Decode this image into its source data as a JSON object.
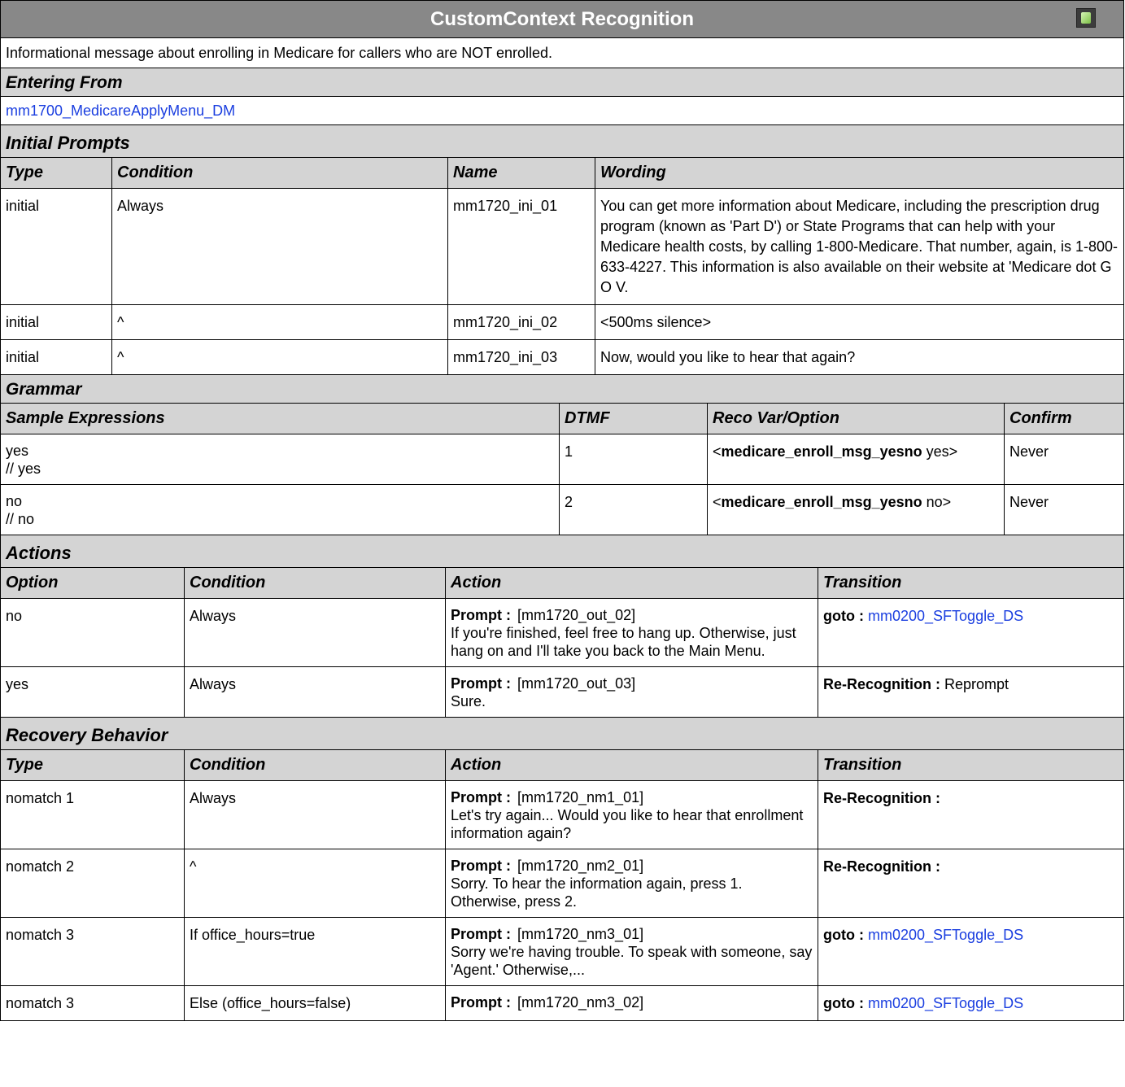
{
  "title": "CustomContext Recognition",
  "description": "Informational message about enrolling in Medicare for callers who are NOT enrolled.",
  "entering_from": {
    "label": "Entering From",
    "link": "mm1700_MedicareApplyMenu_DM"
  },
  "initial_prompts": {
    "label": "Initial Prompts",
    "columns": [
      "Type",
      "Condition",
      "Name",
      "Wording"
    ],
    "rows": [
      {
        "type": "initial",
        "condition": "Always",
        "name": "mm1720_ini_01",
        "wording": "You can get more information about Medicare, including the prescription drug program (known as 'Part D') or State Programs that can help with your Medicare health costs, by calling 1-800-Medicare. That number, again, is 1-800-633-4227. This information is also available on their website at 'Medicare dot G O V."
      },
      {
        "type": "initial",
        "condition": "^",
        "name": "mm1720_ini_02",
        "wording": "<500ms silence>"
      },
      {
        "type": "initial",
        "condition": "^",
        "name": "mm1720_ini_03",
        "wording": "Now, would you like to hear that again?"
      }
    ]
  },
  "grammar": {
    "label": "Grammar",
    "columns": [
      "Sample Expressions",
      "DTMF",
      "Reco Var/Option",
      "Confirm"
    ],
    "rows": [
      {
        "expr": "yes",
        "expr_comment": "// yes",
        "dtmf": "1",
        "var_open": "<",
        "var_name": "medicare_enroll_msg_yesno",
        "var_value": " yes>",
        "confirm": "Never"
      },
      {
        "expr": "no",
        "expr_comment": "// no",
        "dtmf": "2",
        "var_open": "<",
        "var_name": "medicare_enroll_msg_yesno",
        "var_value": " no>",
        "confirm": "Never"
      }
    ]
  },
  "actions": {
    "label": "Actions",
    "columns": [
      "Option",
      "Condition",
      "Action",
      "Transition"
    ],
    "rows": [
      {
        "option": "no",
        "condition": "Always",
        "prompt_label": "Prompt :",
        "prompt_id": "[mm1720_out_02]",
        "prompt_text": "If you're finished, feel free to hang up. Otherwise, just hang on and I'll take you back to the Main Menu.",
        "trans_label": "goto :",
        "trans_value": "mm0200_SFToggle_DS",
        "trans_is_link": true
      },
      {
        "option": "yes",
        "condition": "Always",
        "prompt_label": "Prompt :",
        "prompt_id": "[mm1720_out_03]",
        "prompt_text": "Sure.",
        "trans_label": "Re-Recognition :",
        "trans_value": "Reprompt",
        "trans_is_link": false
      }
    ]
  },
  "recovery": {
    "label": "Recovery Behavior",
    "columns": [
      "Type",
      "Condition",
      "Action",
      "Transition"
    ],
    "rows": [
      {
        "type": "nomatch 1",
        "condition": "Always",
        "prompt_label": "Prompt :",
        "prompt_id": "[mm1720_nm1_01]",
        "prompt_text": "Let's try again...  Would you like to hear that enrollment information again?",
        "trans_label": "Re-Recognition :",
        "trans_value": "",
        "trans_is_link": false
      },
      {
        "type": "nomatch 2",
        "condition": "^",
        "prompt_label": "Prompt :",
        "prompt_id": "[mm1720_nm2_01]",
        "prompt_text": "Sorry. To hear the information again, press 1. Otherwise, press 2.",
        "trans_label": "Re-Recognition :",
        "trans_value": "",
        "trans_is_link": false
      },
      {
        "type": "nomatch 3",
        "condition": "If office_hours=true",
        "prompt_label": "Prompt :",
        "prompt_id": "[mm1720_nm3_01]",
        "prompt_text": "Sorry we're having trouble. To speak with someone, say 'Agent.' Otherwise,...",
        "trans_label": "goto :",
        "trans_value": "mm0200_SFToggle_DS",
        "trans_is_link": true
      },
      {
        "type": "nomatch 3",
        "condition": "Else (office_hours=false)",
        "prompt_label": "Prompt :",
        "prompt_id": "[mm1720_nm3_02]",
        "prompt_text": "",
        "trans_label": "goto :",
        "trans_value": "mm0200_SFToggle_DS",
        "trans_is_link": true
      }
    ]
  },
  "icon": "speaker-head-icon"
}
